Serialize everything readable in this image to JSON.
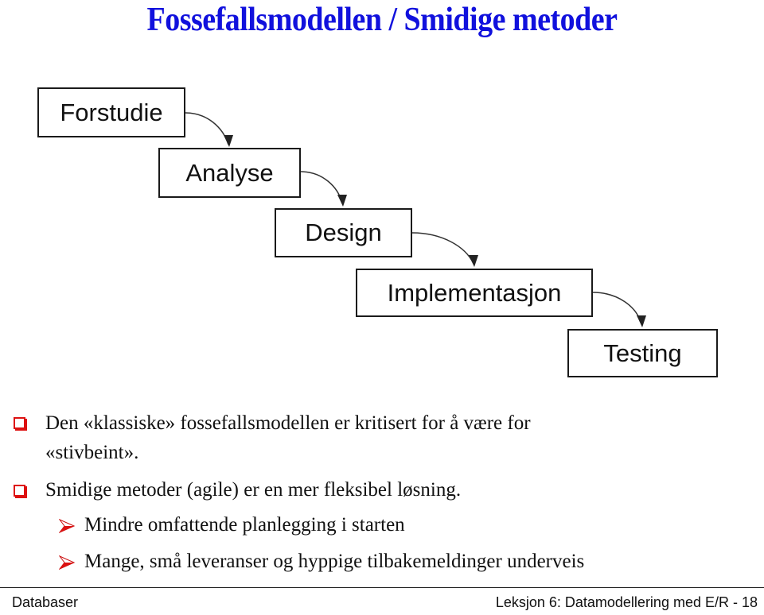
{
  "slide": {
    "title": "Fossefallsmodellen / Smidige metoder"
  },
  "diagram": {
    "phases": [
      {
        "label": "Forstudie"
      },
      {
        "label": "Analyse"
      },
      {
        "label": "Design"
      },
      {
        "label": "Implementasjon"
      },
      {
        "label": "Testing"
      }
    ]
  },
  "bullets": [
    {
      "level": 1,
      "icon": "square-bullet-icon",
      "lines": [
        "Den «klassiske» fossefallsmodellen er kritisert for å være for",
        "«stivbeint»."
      ]
    },
    {
      "level": 1,
      "icon": "square-bullet-icon",
      "lines": [
        "Smidige metoder (agile) er en mer fleksibel løsning."
      ]
    },
    {
      "level": 2,
      "icon": "arrow-bullet-icon",
      "lines": [
        "Mindre omfattende planlegging i starten"
      ]
    },
    {
      "level": 2,
      "icon": "arrow-bullet-icon",
      "lines": [
        "Mange, små leveranser og hyppige tilbakemeldinger underveis"
      ]
    }
  ],
  "footer": {
    "left": "Databaser",
    "right": "Leksjon 6: Datamodellering med E/R - 18"
  },
  "colors": {
    "title": "#1111dd",
    "bullet": "#dd1111"
  }
}
